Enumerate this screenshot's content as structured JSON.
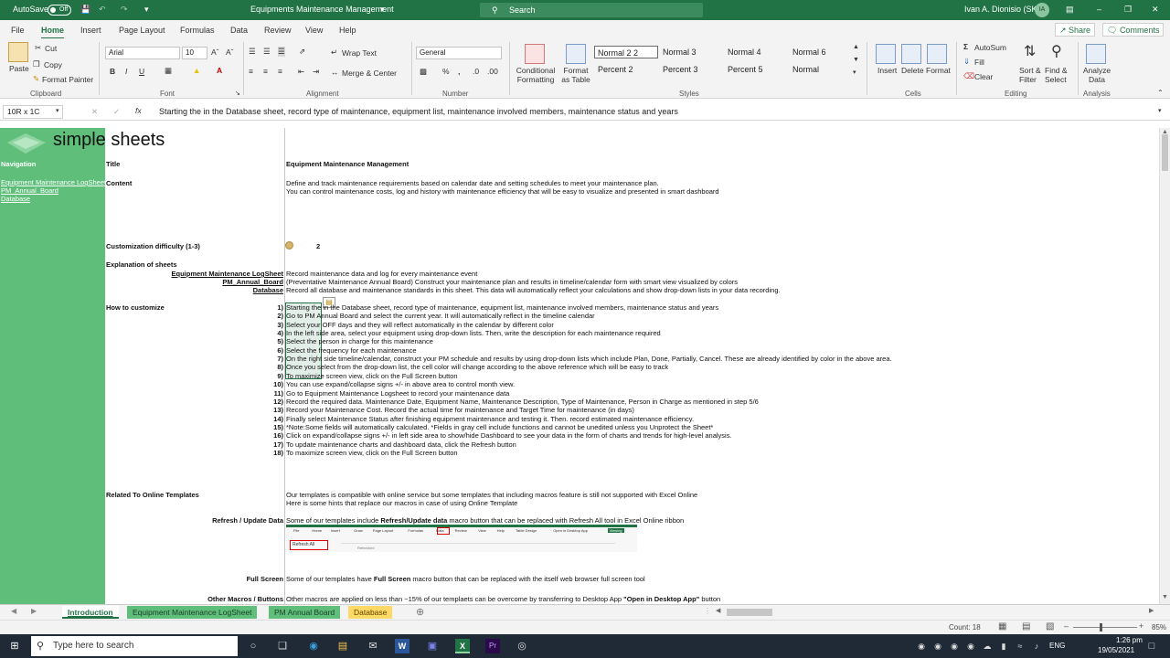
{
  "titlebar": {
    "autosave": "AutoSave",
    "toggle": "Off",
    "doc_title": "Equipments Maintenance Management",
    "search": "Search",
    "user": "Ivan A. Dionisio (SK)",
    "initials": "IA"
  },
  "ribbon_tabs": [
    "File",
    "Home",
    "Insert",
    "Page Layout",
    "Formulas",
    "Data",
    "Review",
    "View",
    "Help"
  ],
  "share": "Share",
  "comments": "Comments",
  "ribbon": {
    "paste": "Paste",
    "cut": "Cut",
    "copy": "Copy",
    "format_painter": "Format Painter",
    "clipboard": "Clipboard",
    "font_name": "Arial",
    "font_size": "10",
    "font": "Font",
    "wrap_text": "Wrap Text",
    "merge_center": "Merge & Center",
    "alignment": "Alignment",
    "number_format": "General",
    "number": "Number",
    "conditional_formatting": "Conditional Formatting",
    "format_as_table": "Format as Table",
    "styles_row1": [
      "Normal 2 2",
      "Normal 3",
      "Normal 4",
      "Normal 6"
    ],
    "styles_row2": [
      "Percent 2",
      "Percent 3",
      "Percent 5",
      "Normal"
    ],
    "styles": "Styles",
    "insert": "Insert",
    "delete": "Delete",
    "format": "Format",
    "cells": "Cells",
    "autosum": "AutoSum",
    "fill": "Fill",
    "clear": "Clear",
    "sort_filter": "Sort & Filter",
    "find_select": "Find & Select",
    "editing": "Editing",
    "analyze_data": "Analyze Data",
    "analysis": "Analysis"
  },
  "formula_bar": {
    "namebox": "10R x 1C",
    "formula": "Starting the in the Database sheet, record type of maintenance, equipment list, maintenance involved members, maintenance status and years"
  },
  "sheet": {
    "logo": "simple sheets",
    "navigation": "Navigation",
    "nav_links": [
      "Equipment Maintenance LogSheet",
      "PM_Annual_Board",
      "Database"
    ],
    "title_label": "Title",
    "title_value": "Equipment Maintenance Management",
    "content_label": "Content",
    "content_lines": [
      "Define and track maintenance requirements based on calendar date and setting schedules to meet your maintenance plan.",
      "You can control maintenance costs, log and history with maintenance efficiency that will be easy to visualize and presented in smart dashboard"
    ],
    "difficulty_label": "Customization difficulty (1-3)",
    "difficulty_value": "2",
    "explanation_label": "Explanation of sheets",
    "sheets_explained": [
      {
        "name": "Equipment Maintenance LogSheet",
        "desc": "Record maintenance data and log for every maintenance event"
      },
      {
        "name": "PM_Annual_Board",
        "desc": "(Preventative Maintenance Annual Board) Construct your maintenance plan and results in timeline/calendar form with smart view visualized by colors"
      },
      {
        "name": "Database",
        "desc": "Record all database and maintenance standards in this sheet. This  data will automatically reflect your calculations and show drop-down lists in your data recording."
      }
    ],
    "how_label": "How to customize",
    "steps": [
      {
        "n": "1)",
        "t": "Starting the in the Database sheet, record type of maintenance, equipment list, maintenance involved members, maintenance status and years"
      },
      {
        "n": "2)",
        "t": "Go to PM Annual Board and select the current year. It will automatically reflect in the timeline calendar"
      },
      {
        "n": "3)",
        "t": "Select your OFF days and they will reflect automatically in the calendar by different color"
      },
      {
        "n": "4)",
        "t": "In the left side area, select your equipment using drop-down lists. Then, write the description for each maintenance required"
      },
      {
        "n": "5)",
        "t": "Select the person in charge for this maintenance"
      },
      {
        "n": "6)",
        "t": "Select the frequency for each maintenance"
      },
      {
        "n": "7)",
        "t": "On the right side timeline/calendar, construct your PM schedule and results by using drop-down lists which include Plan, Done, Partially, Cancel. These are already identified by color in the above area."
      },
      {
        "n": "8)",
        "t": "Once you select from the drop-down list, the cell color will change according to the above reference which will be easy to track"
      },
      {
        "n": "9)",
        "t": "To maximize screen view, click on the Full Screen button"
      },
      {
        "n": "10)",
        "t": "You can use expand/collapse signs +/- in above area to control month view."
      },
      {
        "n": "11)",
        "t": "Go to Equipment Maintenance Logsheet to record your maintenance data"
      },
      {
        "n": "12)",
        "t": "Record the required data. Maintenance Date, Equipment Name, Maintenance Description, Type of Maintenance, Person in Charge as mentioned in step 5/6"
      },
      {
        "n": "13)",
        "t": "Record your Maintenance Cost. Record the actual time for maintenance and Target Time for maintenance (in days)"
      },
      {
        "n": "14)",
        "t": "Finally select Maintenance Status after finishing equipment maintenance and testing it. Then. record estimated maintenance efficiency."
      },
      {
        "n": "15)",
        "t": "*Note:Some fields will automatically calculated. *Fields in gray cell include functions and cannot be unedited unless you Unprotect the Sheet*"
      },
      {
        "n": "16)",
        "t": "Click on expand/collapse signs +/-  in left side area to show/hide Dashboard to see your data in the form of charts and trends for high-level analysis."
      },
      {
        "n": "17)",
        "t": "To update maintenance charts and dashboard data, click the Refresh button"
      },
      {
        "n": "18)",
        "t": "To maximize screen view, click on the Full Screen button"
      }
    ],
    "related_label": "Related To Online Templates",
    "related_lines": [
      "Our templates is compatible with online service but some templates that including macros feature is still not supported with Excel Online",
      "Here is some hints that replace our macros in case of using Online Template"
    ],
    "refresh_label": "Refresh / Update Data",
    "refresh_pre": "Some of our templates include ",
    "refresh_bold": "Refresh/Update data",
    "refresh_post": " macro button that can be replaced with Refresh All tool in Excel Online ribbon",
    "fullscreen_label": "Full Screen",
    "fullscreen_pre": "Some of our templates have ",
    "fullscreen_bold": "Full Screen",
    "fullscreen_post": " macro button that can be replaced with the itself web browser full screen tool",
    "other_label": "Other Macros / Buttons",
    "other_pre": "Other macros are applied on less than ~15% of our templaets can be overcome by transferring to Desktop App ",
    "other_bold": "\"Open in Desktop App\"",
    "other_post": " button",
    "mini_ribbon": {
      "tabs": [
        "File",
        "Home",
        "Insert",
        "Draw",
        "Page Layout",
        "Formulas",
        "Data",
        "Review",
        "View",
        "Help",
        "Table Design",
        "Open in Desktop App",
        "Viewing"
      ],
      "refresh_all": "Refresh All",
      "refresh_hint": "Refreshed"
    }
  },
  "sheet_tabs": [
    "Introduction",
    "Equipment Maintenance LogSheet",
    "PM Annual Board",
    "Database"
  ],
  "status": {
    "count": "Count: 18",
    "zoom": "85%"
  },
  "taskbar": {
    "search": "Type here to search",
    "lang": "ENG",
    "time": "1:26 pm",
    "date": "19/05/2021"
  }
}
